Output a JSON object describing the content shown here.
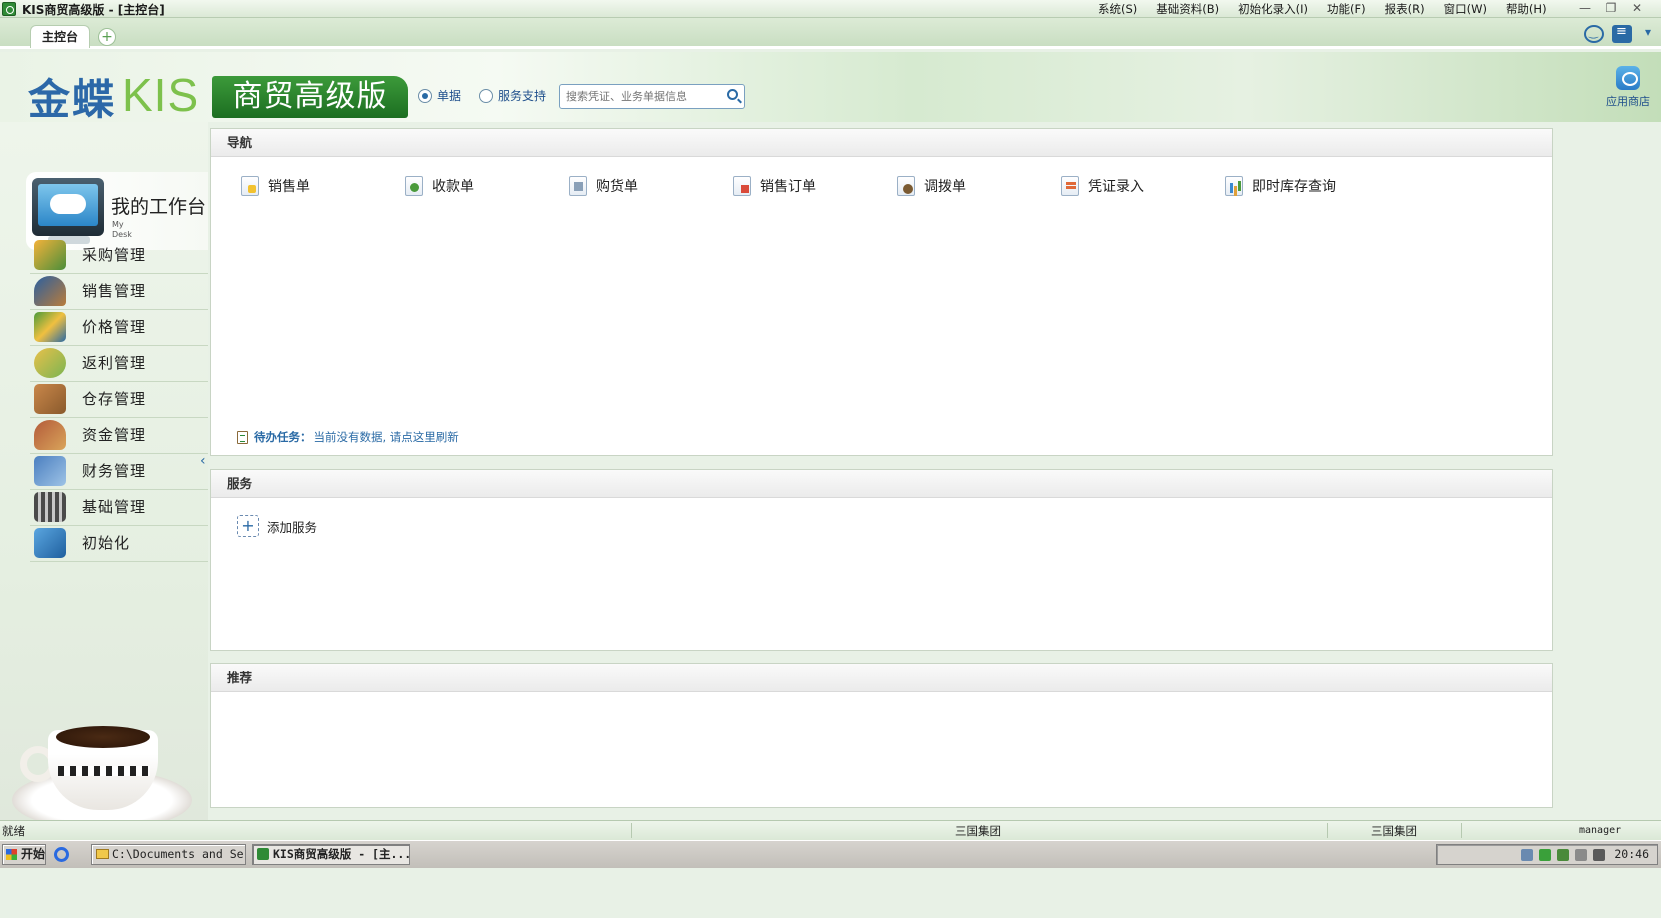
{
  "window": {
    "title": "KIS商贸高级版 - [主控台]",
    "menus": [
      "系统(S)",
      "基础资料(B)",
      "初始化录入(I)",
      "功能(F)",
      "报表(R)",
      "窗口(W)",
      "帮助(H)"
    ]
  },
  "tabs": {
    "main": "主控台",
    "add": "+"
  },
  "banner": {
    "logo_cn": "金蝶",
    "logo_kis": "KIS",
    "edition": "商贸高级版",
    "radio_doc": "单据",
    "radio_service": "服务支持",
    "search_placeholder": "搜索凭证、业务单据信息",
    "app_store": "应用商店"
  },
  "sidebar": {
    "desk_title": "我的工作台",
    "desk_en_1": "My",
    "desk_en_2": "Desk",
    "items": [
      {
        "label": "采购管理",
        "icon": "purchase"
      },
      {
        "label": "销售管理",
        "icon": "sales"
      },
      {
        "label": "价格管理",
        "icon": "price"
      },
      {
        "label": "返利管理",
        "icon": "rebate"
      },
      {
        "label": "仓存管理",
        "icon": "warehouse"
      },
      {
        "label": "资金管理",
        "icon": "fund"
      },
      {
        "label": "财务管理",
        "icon": "finance"
      },
      {
        "label": "基础管理",
        "icon": "basic"
      },
      {
        "label": "初始化",
        "icon": "init"
      }
    ]
  },
  "nav_panel": {
    "title": "导航",
    "links": [
      {
        "label": "销售单",
        "icon": "doc-sales"
      },
      {
        "label": "收款单",
        "icon": "doc-receipt"
      },
      {
        "label": "购货单",
        "icon": "doc-purchase"
      },
      {
        "label": "销售订单",
        "icon": "doc-order"
      },
      {
        "label": "调拨单",
        "icon": "doc-transfer"
      },
      {
        "label": "凭证录入",
        "icon": "doc-voucher"
      },
      {
        "label": "即时库存查询",
        "icon": "doc-stock"
      }
    ],
    "todo_label": "待办任务：",
    "todo_text": "当前没有数据, 请点这里刷新"
  },
  "service_panel": {
    "title": "服务",
    "add_label": "添加服务"
  },
  "recommend_panel": {
    "title": "推荐"
  },
  "statusbar": {
    "status": "就绪",
    "company1": "三国集团",
    "company2": "三国集团",
    "user": "manager"
  },
  "taskbar": {
    "start": "开始",
    "task1": "C:\\Documents and Se...",
    "task2": "KIS商贸高级版 - [主...",
    "clock": "20:46"
  },
  "colors": {
    "brand_blue": "#2c68a8",
    "brand_green": "#7dc14c",
    "edition_bg": "#1c6e21"
  }
}
